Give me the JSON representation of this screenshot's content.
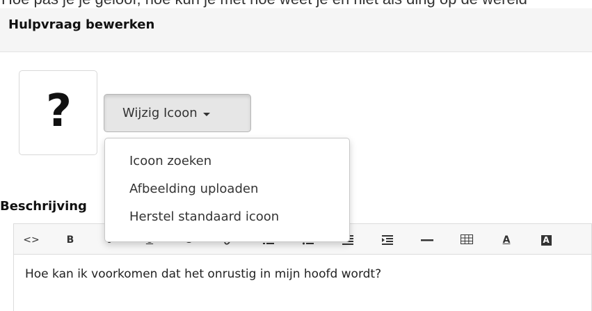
{
  "top_strip_text": "Hoe pas je je geloof, hoe kun je met hoe weet je en niet als ding op de wereld",
  "panel": {
    "title": "Hulpvraag bewerken"
  },
  "icon": {
    "glyph": "?",
    "name": "question-mark-icon"
  },
  "change_icon_button": {
    "label": "Wijzig Icoon"
  },
  "dropdown": {
    "items": [
      {
        "label": "Icoon zoeken"
      },
      {
        "label": "Afbeelding uploaden"
      },
      {
        "label": "Herstel standaard icoon"
      }
    ]
  },
  "description": {
    "label": "Beschrijving"
  },
  "toolbar": {
    "buttons": [
      {
        "name": "code-view-icon",
        "glyph": "<>"
      },
      {
        "name": "bold-icon",
        "glyph": "B"
      },
      {
        "name": "italic-icon",
        "glyph": "I"
      },
      {
        "name": "underline-icon",
        "glyph": "U"
      },
      {
        "name": "strikethrough-icon",
        "glyph": "S"
      },
      {
        "name": "link-icon",
        "glyph": "link"
      },
      {
        "name": "ordered-list-icon",
        "glyph": "ol"
      },
      {
        "name": "unordered-list-icon",
        "glyph": "ul"
      },
      {
        "name": "outdent-icon",
        "glyph": "outdent"
      },
      {
        "name": "indent-icon",
        "glyph": "indent"
      },
      {
        "name": "horizontal-rule-icon",
        "glyph": "hr"
      },
      {
        "name": "table-icon",
        "glyph": "table"
      },
      {
        "name": "text-color-icon",
        "glyph": "A"
      },
      {
        "name": "background-color-icon",
        "glyph": "A"
      }
    ]
  },
  "editor": {
    "content": "Hoe kan ik voorkomen dat het onrustig in mijn hoofd wordt?"
  }
}
